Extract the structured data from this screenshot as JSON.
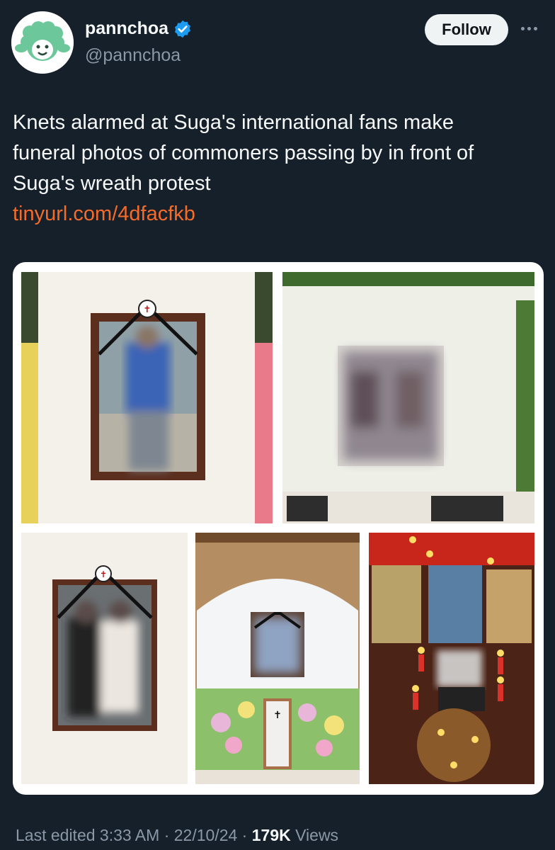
{
  "author": {
    "display_name": "pannchoa",
    "handle": "@pannchoa",
    "verified": true,
    "avatar_icon": "green-sheep-face-icon",
    "avatar_color": "#6cc79a"
  },
  "actions": {
    "follow_label": "Follow",
    "more_icon": "more-options-icon"
  },
  "tweet": {
    "text_lines": [
      "Knets alarmed at Suga's international fans make",
      "funeral photos of commoners passing by in front of",
      "Suga's wreath protest"
    ],
    "link": "tinyurl.com/4dfacfkb",
    "link_color": "#f56b2a"
  },
  "media": {
    "images": [
      "funeral-wreath-photo-1",
      "funeral-wreath-photo-2",
      "funeral-wreath-photo-3",
      "funeral-altar-photo-4",
      "candle-altar-photo-5"
    ]
  },
  "footer": {
    "edited": "Last edited 3:33 AM",
    "sep1": " · ",
    "date": "22/10/24",
    "sep2": " · ",
    "views_count": "179K",
    "views_label": " Views"
  }
}
